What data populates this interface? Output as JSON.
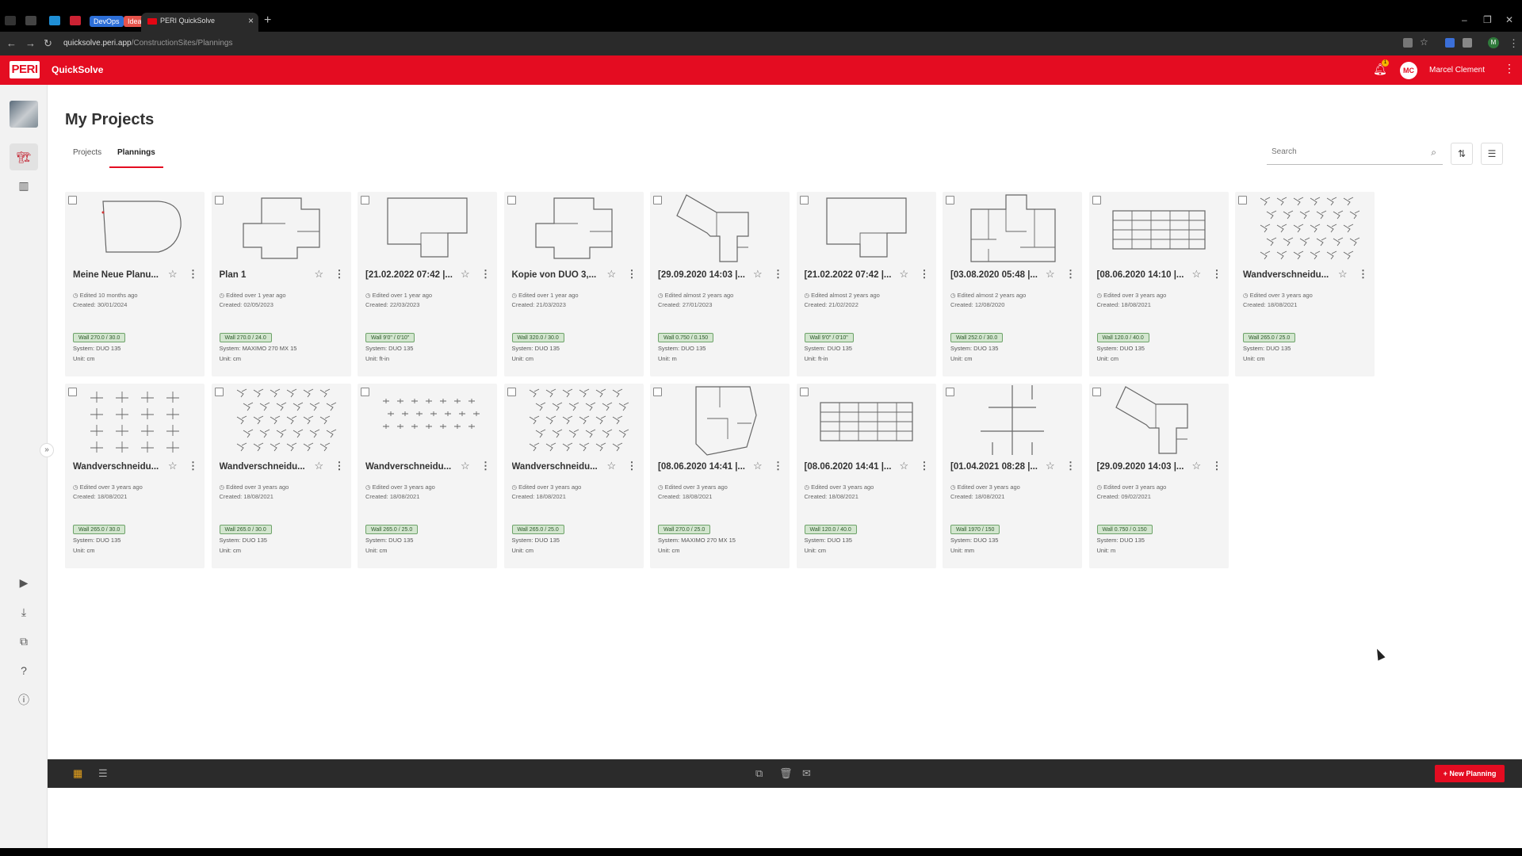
{
  "browser": {
    "tab_pills": [
      "DevOps",
      "Idea"
    ],
    "active_tab_title": "PERI QuickSolve",
    "url_host": "quicksolve.peri.app",
    "url_path": "/ConstructionSites/Plannings",
    "profile_letter": "M"
  },
  "app": {
    "logo": "PERI",
    "name": "QuickSolve",
    "notification_count": "1",
    "user_initials": "MC",
    "user_name": "Marcel Clement"
  },
  "page": {
    "title": "My Projects",
    "tabs": [
      {
        "label": "Projects",
        "active": false
      },
      {
        "label": "Plannings",
        "active": true
      }
    ],
    "search_placeholder": "Search"
  },
  "cards": [
    {
      "name": "Meine Neue Planu...",
      "edited": "Edited 10 months ago",
      "created": "Created: 30/01/2024",
      "wall": "Wall 270.0 / 30.0",
      "system": "System: DUO 135",
      "unit": "Unit: cm",
      "thumb": "round"
    },
    {
      "name": "Plan 1",
      "edited": "Edited over 1 year ago",
      "created": "Created: 02/05/2023",
      "wall": "Wall 270.0 / 24.0",
      "system": "System: MAXIMO 270 MX 15",
      "unit": "Unit: cm",
      "thumb": "cross"
    },
    {
      "name": "[21.02.2022 07:42 |...",
      "edited": "Edited over 1 year ago",
      "created": "Created: 22/03/2023",
      "wall": "Wall 9'0\" / 0'10\"",
      "system": "System: DUO 135",
      "unit": "Unit: ft-in",
      "thumb": "house"
    },
    {
      "name": "Kopie von DUO 3,...",
      "edited": "Edited over 1 year ago",
      "created": "Created: 21/03/2023",
      "wall": "Wall 320.0 / 30.0",
      "system": "System: DUO 135",
      "unit": "Unit: cm",
      "thumb": "cross"
    },
    {
      "name": "[29.09.2020 14:03 |...",
      "edited": "Edited almost 2 years ago",
      "created": "Created: 27/01/2023",
      "wall": "Wall 0.750 / 0.150",
      "system": "System: DUO 135",
      "unit": "Unit: m",
      "thumb": "angled"
    },
    {
      "name": "[21.02.2022 07:42 |...",
      "edited": "Edited almost 2 years ago",
      "created": "Created: 21/02/2022",
      "wall": "Wall 9'0\" / 0'10\"",
      "system": "System: DUO 135",
      "unit": "Unit: ft-in",
      "thumb": "house"
    },
    {
      "name": "[03.08.2020 05:48 |...",
      "edited": "Edited almost 2 years ago",
      "created": "Created: 12/08/2020",
      "wall": "Wall 252.0 / 30.0",
      "system": "System: DUO 135",
      "unit": "Unit: cm",
      "thumb": "complex"
    },
    {
      "name": "[08.06.2020 14:10 |...",
      "edited": "Edited over 3 years ago",
      "created": "Created: 18/08/2021",
      "wall": "Wall 120.0 / 40.0",
      "system": "System: DUO 135",
      "unit": "Unit: cm",
      "thumb": "gridrect"
    },
    {
      "name": "Wandverschneidu...",
      "edited": "Edited over 3 years ago",
      "created": "Created: 18/08/2021",
      "wall": "Wall 265.0 / 25.0",
      "system": "System: DUO 135",
      "unit": "Unit: cm",
      "thumb": "scatter"
    },
    {
      "name": "Wandverschneidu...",
      "edited": "Edited over 3 years ago",
      "created": "Created: 18/08/2021",
      "wall": "Wall 265.0 / 30.0",
      "system": "System: DUO 135",
      "unit": "Unit: cm",
      "thumb": "tees"
    },
    {
      "name": "Wandverschneidu...",
      "edited": "Edited over 3 years ago",
      "created": "Created: 18/08/2021",
      "wall": "Wall 265.0 / 30.0",
      "system": "System: DUO 135",
      "unit": "Unit: cm",
      "thumb": "scatter"
    },
    {
      "name": "Wandverschneidu...",
      "edited": "Edited over 3 years ago",
      "created": "Created: 18/08/2021",
      "wall": "Wall 265.0 / 25.0",
      "system": "System: DUO 135",
      "unit": "Unit: cm",
      "thumb": "dots"
    },
    {
      "name": "Wandverschneidu...",
      "edited": "Edited over 3 years ago",
      "created": "Created: 18/08/2021",
      "wall": "Wall 265.0 / 25.0",
      "system": "System: DUO 135",
      "unit": "Unit: cm",
      "thumb": "scatter"
    },
    {
      "name": "[08.06.2020 14:41 |...",
      "edited": "Edited over 3 years ago",
      "created": "Created: 18/08/2021",
      "wall": "Wall 270.0 / 25.0",
      "system": "System: MAXIMO 270 MX 15",
      "unit": "Unit: cm",
      "thumb": "poly"
    },
    {
      "name": "[08.06.2020 14:41 |...",
      "edited": "Edited over 3 years ago",
      "created": "Created: 18/08/2021",
      "wall": "Wall 120.0 / 40.0",
      "system": "System: DUO 135",
      "unit": "Unit: cm",
      "thumb": "gridrect"
    },
    {
      "name": "[01.04.2021 08:28 |...",
      "edited": "Edited over 3 years ago",
      "created": "Created: 18/08/2021",
      "wall": "Wall 1970 / 150",
      "system": "System: DUO 135",
      "unit": "Unit: mm",
      "thumb": "lines"
    },
    {
      "name": "[29.09.2020 14:03 |...",
      "edited": "Edited over 3 years ago",
      "created": "Created: 09/02/2021",
      "wall": "Wall 0.750 / 0.150",
      "system": "System: DUO 135",
      "unit": "Unit: m",
      "thumb": "angled"
    }
  ],
  "bottom": {
    "new_label": "+ New Planning"
  }
}
